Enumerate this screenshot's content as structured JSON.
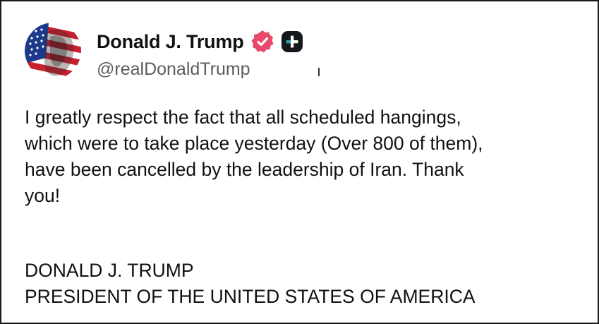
{
  "post": {
    "author": {
      "display_name": "Donald J. Trump",
      "handle": "@realDonaldTrump",
      "avatar_icon": "flag-portrait-avatar",
      "verified_badge_icon": "verified-badge-icon",
      "verified_badge_color": "#e8496a",
      "follow_icon": "plus-icon"
    },
    "body_lines": [
      "I greatly respect the fact that all scheduled hangings,",
      "which were to take place yesterday (Over 800 of them),",
      "have been cancelled by the leadership of Iran. Thank",
      "you!"
    ],
    "signature": {
      "name": "DONALD J. TRUMP",
      "title": "PRESIDENT OF THE UNITED STATES OF AMERICA"
    }
  }
}
